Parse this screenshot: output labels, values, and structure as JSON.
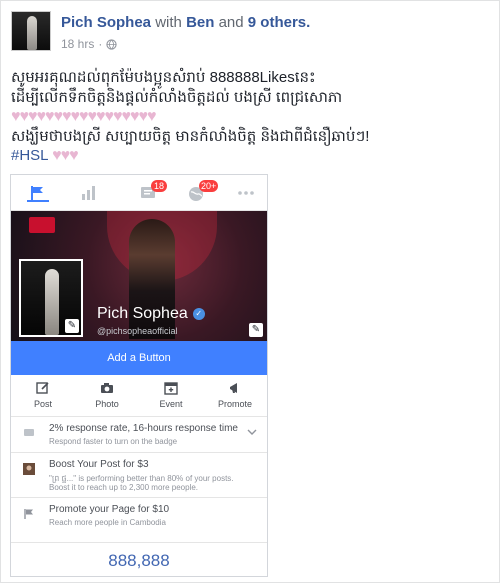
{
  "post": {
    "author": "Pich Sophea",
    "with_word": "with",
    "tagged_first": "Ben",
    "and_word": "and",
    "tagged_others": "9 others.",
    "time": "18 hrs",
    "privacy_icon": "globe-icon",
    "lines": [
      "សូមអរគុណដល់ពុកម៉ែបងប្អូនសំរាប់ 888888Likesនេះ",
      "ដើម្បីលើកទឹកចិត្តនិងផ្ដល់កំលាំងចិត្តដល់ បងស្រី ពេជ្រសោភា",
      "♥♥♥♥♥♥♥♥♥♥♥♥♥♥♥♥♥",
      "សង្ឃឹមថាបងស្រី សប្បាយចិត្ត មានកំលាំងចិត្ត និងជាពីជំនឿឆាប់ៗ!"
    ],
    "hashtag": "#HSL",
    "hashtag_hearts": "♥♥♥"
  },
  "screenshot": {
    "tabs": [
      {
        "name": "flag-icon"
      },
      {
        "name": "insights-icon"
      },
      {
        "name": "messages-icon",
        "badge": "18"
      },
      {
        "name": "notifications-globe-icon",
        "badge": "20+"
      },
      {
        "name": "more-icon"
      }
    ],
    "page_name": "Pich Sophea",
    "handle": "@pichsopheaofficial",
    "add_button": "Add a Button",
    "actions": [
      {
        "label": "Post",
        "icon": "compose-icon"
      },
      {
        "label": "Photo",
        "icon": "camera-icon"
      },
      {
        "label": "Event",
        "icon": "event-icon"
      },
      {
        "label": "Promote",
        "icon": "megaphone-icon"
      }
    ],
    "rows": [
      {
        "title": "2% response rate, 16-hours response time",
        "sub": "Respond faster to turn on the badge",
        "sub2": ""
      },
      {
        "title": "Boost Your Post for $3",
        "sub": "\"ព្រ ផ្ឋ...\" is performing better than 80% of your posts.",
        "sub2": "Boost it to reach up to 2,300 more people."
      },
      {
        "title": "Promote your Page for $10",
        "sub": "Reach more people in Cambodia",
        "sub2": ""
      }
    ],
    "likes_count": "888,888",
    "accent": "#4080ff",
    "badge_color": "#fa3e3e"
  }
}
